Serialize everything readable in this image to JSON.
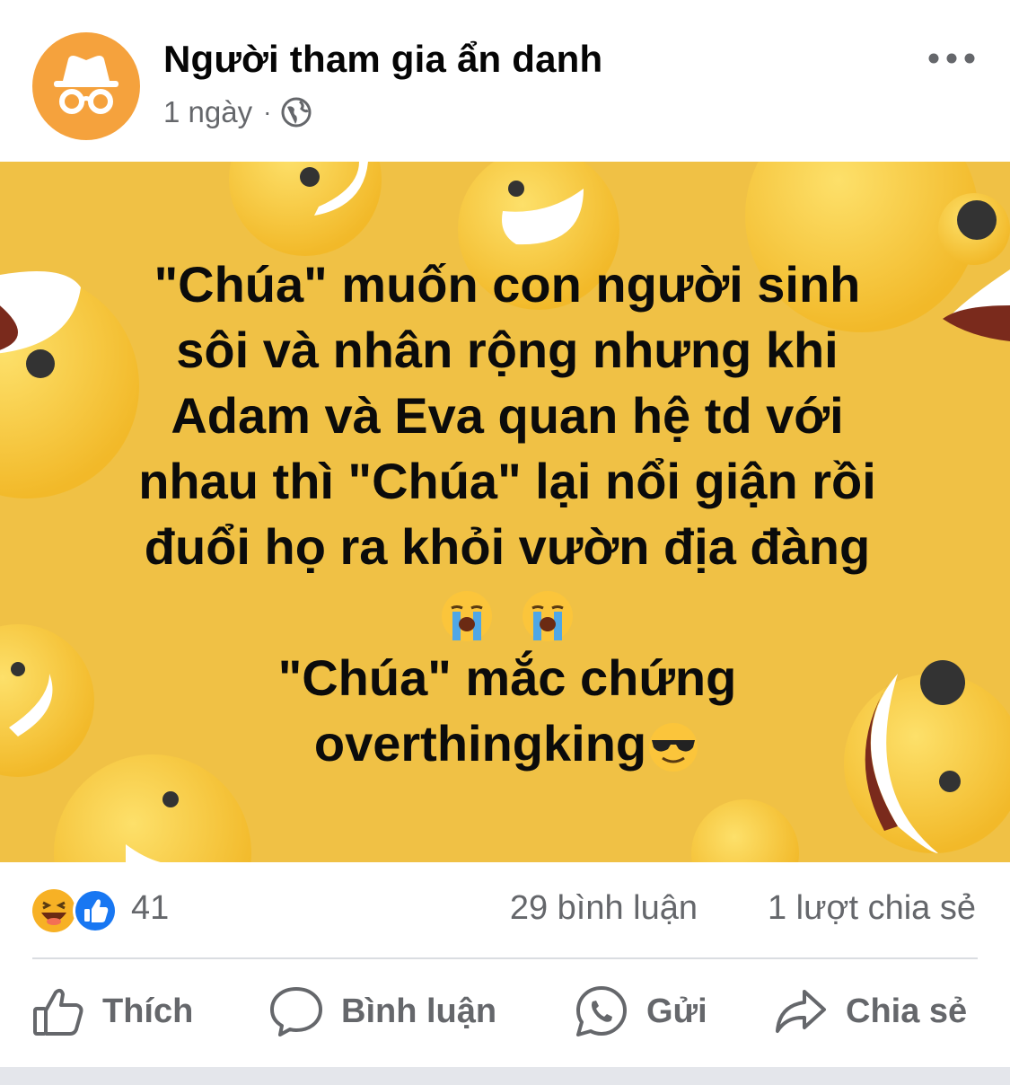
{
  "post": {
    "author": "Người tham gia ẩn danh",
    "time": "1 ngày",
    "privacy_icon": "globe-icon",
    "menu_icon": "more-dots-icon",
    "avatar_icon": "incognito-icon"
  },
  "image": {
    "lines": [
      "\"Chúa\" muốn con người sinh",
      "sôi và nhân rộng nhưng khi",
      "Adam và Eva quan hệ td với",
      "nhau thì \"Chúa\" lại nổi giận rồi",
      "đuổi họ ra khỏi vườn địa đàng"
    ],
    "emoji_line": [
      "loudly-crying-face",
      "loudly-crying-face"
    ],
    "line_after_1": "\"Chúa\" mắc chứng",
    "line_after_2": "overthingking",
    "trailing_emoji": "sunglasses-face",
    "background_color": "#f0c145"
  },
  "stats": {
    "reaction_icons": [
      "haha-icon",
      "like-icon"
    ],
    "reaction_count": "41",
    "comments": "29 bình luận",
    "shares": "1 lượt chia sẻ"
  },
  "actions": {
    "like": "Thích",
    "comment": "Bình luận",
    "send": "Gửi",
    "share": "Chia sẻ"
  },
  "colors": {
    "text": "#050505",
    "secondary": "#65676b",
    "avatar": "#f5a23d",
    "like_blue": "#1877f2"
  }
}
